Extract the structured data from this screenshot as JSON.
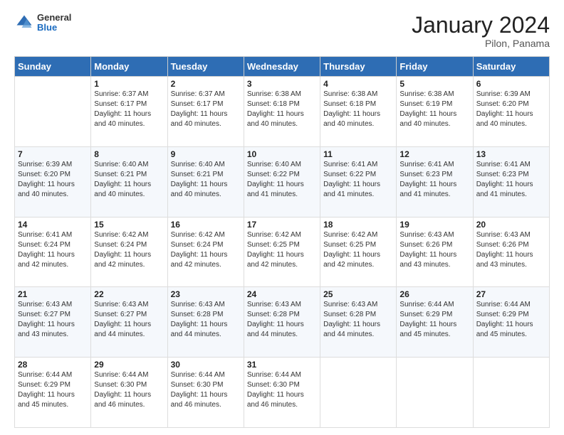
{
  "header": {
    "logo": {
      "general": "General",
      "blue": "Blue"
    },
    "title": "January 2024",
    "subtitle": "Pilon, Panama"
  },
  "calendar": {
    "weekdays": [
      "Sunday",
      "Monday",
      "Tuesday",
      "Wednesday",
      "Thursday",
      "Friday",
      "Saturday"
    ],
    "weeks": [
      [
        {
          "day": "",
          "info": ""
        },
        {
          "day": "1",
          "info": "Sunrise: 6:37 AM\nSunset: 6:17 PM\nDaylight: 11 hours\nand 40 minutes."
        },
        {
          "day": "2",
          "info": "Sunrise: 6:37 AM\nSunset: 6:17 PM\nDaylight: 11 hours\nand 40 minutes."
        },
        {
          "day": "3",
          "info": "Sunrise: 6:38 AM\nSunset: 6:18 PM\nDaylight: 11 hours\nand 40 minutes."
        },
        {
          "day": "4",
          "info": "Sunrise: 6:38 AM\nSunset: 6:18 PM\nDaylight: 11 hours\nand 40 minutes."
        },
        {
          "day": "5",
          "info": "Sunrise: 6:38 AM\nSunset: 6:19 PM\nDaylight: 11 hours\nand 40 minutes."
        },
        {
          "day": "6",
          "info": "Sunrise: 6:39 AM\nSunset: 6:20 PM\nDaylight: 11 hours\nand 40 minutes."
        }
      ],
      [
        {
          "day": "7",
          "info": "Sunrise: 6:39 AM\nSunset: 6:20 PM\nDaylight: 11 hours\nand 40 minutes."
        },
        {
          "day": "8",
          "info": "Sunrise: 6:40 AM\nSunset: 6:21 PM\nDaylight: 11 hours\nand 40 minutes."
        },
        {
          "day": "9",
          "info": "Sunrise: 6:40 AM\nSunset: 6:21 PM\nDaylight: 11 hours\nand 40 minutes."
        },
        {
          "day": "10",
          "info": "Sunrise: 6:40 AM\nSunset: 6:22 PM\nDaylight: 11 hours\nand 41 minutes."
        },
        {
          "day": "11",
          "info": "Sunrise: 6:41 AM\nSunset: 6:22 PM\nDaylight: 11 hours\nand 41 minutes."
        },
        {
          "day": "12",
          "info": "Sunrise: 6:41 AM\nSunset: 6:23 PM\nDaylight: 11 hours\nand 41 minutes."
        },
        {
          "day": "13",
          "info": "Sunrise: 6:41 AM\nSunset: 6:23 PM\nDaylight: 11 hours\nand 41 minutes."
        }
      ],
      [
        {
          "day": "14",
          "info": "Sunrise: 6:41 AM\nSunset: 6:24 PM\nDaylight: 11 hours\nand 42 minutes."
        },
        {
          "day": "15",
          "info": "Sunrise: 6:42 AM\nSunset: 6:24 PM\nDaylight: 11 hours\nand 42 minutes."
        },
        {
          "day": "16",
          "info": "Sunrise: 6:42 AM\nSunset: 6:24 PM\nDaylight: 11 hours\nand 42 minutes."
        },
        {
          "day": "17",
          "info": "Sunrise: 6:42 AM\nSunset: 6:25 PM\nDaylight: 11 hours\nand 42 minutes."
        },
        {
          "day": "18",
          "info": "Sunrise: 6:42 AM\nSunset: 6:25 PM\nDaylight: 11 hours\nand 42 minutes."
        },
        {
          "day": "19",
          "info": "Sunrise: 6:43 AM\nSunset: 6:26 PM\nDaylight: 11 hours\nand 43 minutes."
        },
        {
          "day": "20",
          "info": "Sunrise: 6:43 AM\nSunset: 6:26 PM\nDaylight: 11 hours\nand 43 minutes."
        }
      ],
      [
        {
          "day": "21",
          "info": "Sunrise: 6:43 AM\nSunset: 6:27 PM\nDaylight: 11 hours\nand 43 minutes."
        },
        {
          "day": "22",
          "info": "Sunrise: 6:43 AM\nSunset: 6:27 PM\nDaylight: 11 hours\nand 44 minutes."
        },
        {
          "day": "23",
          "info": "Sunrise: 6:43 AM\nSunset: 6:28 PM\nDaylight: 11 hours\nand 44 minutes."
        },
        {
          "day": "24",
          "info": "Sunrise: 6:43 AM\nSunset: 6:28 PM\nDaylight: 11 hours\nand 44 minutes."
        },
        {
          "day": "25",
          "info": "Sunrise: 6:43 AM\nSunset: 6:28 PM\nDaylight: 11 hours\nand 44 minutes."
        },
        {
          "day": "26",
          "info": "Sunrise: 6:44 AM\nSunset: 6:29 PM\nDaylight: 11 hours\nand 45 minutes."
        },
        {
          "day": "27",
          "info": "Sunrise: 6:44 AM\nSunset: 6:29 PM\nDaylight: 11 hours\nand 45 minutes."
        }
      ],
      [
        {
          "day": "28",
          "info": "Sunrise: 6:44 AM\nSunset: 6:29 PM\nDaylight: 11 hours\nand 45 minutes."
        },
        {
          "day": "29",
          "info": "Sunrise: 6:44 AM\nSunset: 6:30 PM\nDaylight: 11 hours\nand 46 minutes."
        },
        {
          "day": "30",
          "info": "Sunrise: 6:44 AM\nSunset: 6:30 PM\nDaylight: 11 hours\nand 46 minutes."
        },
        {
          "day": "31",
          "info": "Sunrise: 6:44 AM\nSunset: 6:30 PM\nDaylight: 11 hours\nand 46 minutes."
        },
        {
          "day": "",
          "info": ""
        },
        {
          "day": "",
          "info": ""
        },
        {
          "day": "",
          "info": ""
        }
      ]
    ]
  }
}
